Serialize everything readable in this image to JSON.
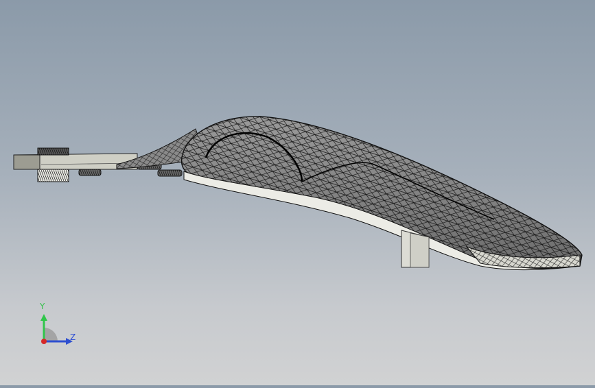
{
  "viewport": {
    "model": "faucet-spout-mesh",
    "background": {
      "top": "#8b9aa9",
      "bottom": "#d1d2d3"
    },
    "colors": {
      "body_fill": "#7d7d7d",
      "underside_fill": "#e8e8e2",
      "mesh_stroke": "#111111",
      "bracket_fill": "#dcdcd4"
    }
  },
  "triad": {
    "y_label": "Y",
    "z_label": "Z",
    "colors": {
      "y": "#2fc64a",
      "z": "#2e4fd0",
      "origin": "#d62828"
    }
  }
}
